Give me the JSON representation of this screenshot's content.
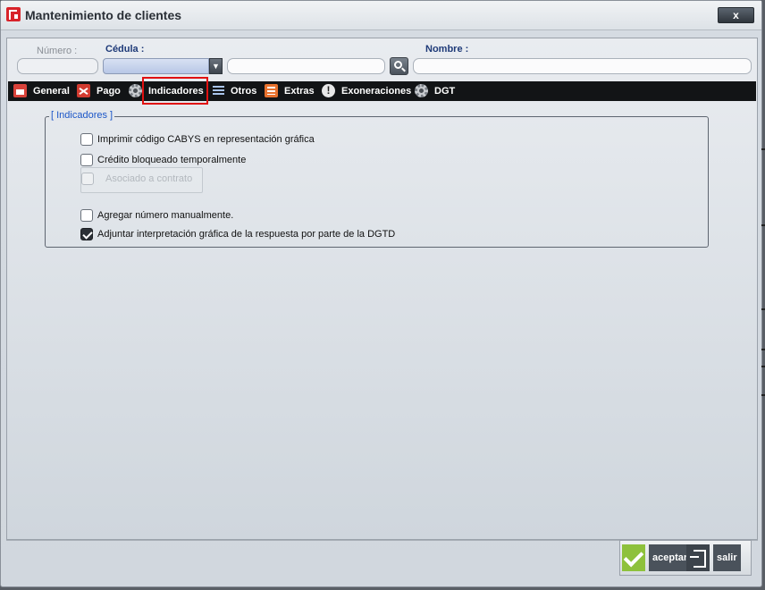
{
  "window": {
    "title": "Mantenimiento de clientes",
    "close_label": "x"
  },
  "header": {
    "numero_label": "Número :",
    "numero_value": "",
    "cedula_label": "Cédula :",
    "cedula_type_value": "",
    "cedula_value": "",
    "nombre_label": "Nombre :",
    "nombre_value": ""
  },
  "tabs": [
    {
      "label": "General",
      "icon": "store-icon"
    },
    {
      "label": "Pago",
      "icon": "shuffle-icon"
    },
    {
      "label": "Indicadores",
      "icon": "gear-icon",
      "active": true
    },
    {
      "label": "Otros",
      "icon": "list-icon"
    },
    {
      "label": "Extras",
      "icon": "list-icon"
    },
    {
      "label": "Exoneraciones",
      "icon": "info-icon"
    },
    {
      "label": "DGT",
      "icon": "gear-icon"
    }
  ],
  "indicadores": {
    "group_title": "[ Indicadores ]",
    "options": [
      {
        "label": "Imprimir código CABYS en representación gráfica",
        "checked": false
      },
      {
        "label": "Crédito bloqueado temporalmente",
        "checked": false
      },
      {
        "label": "Asociado a contrato",
        "checked": false,
        "disabled": true
      },
      {
        "label": "Agregar número manualmente.",
        "checked": false
      },
      {
        "label": "Adjuntar interpretación gráfica de la respuesta por parte de la DGTD",
        "checked": true
      }
    ]
  },
  "footer": {
    "accept_label": "aceptar",
    "exit_label": "salir"
  },
  "colors": {
    "tab_bar": "#121416",
    "label_blue": "#1e3a78",
    "group_title": "#1b56c8",
    "highlight": "#e01010",
    "accept_green": "#8ec13c"
  }
}
